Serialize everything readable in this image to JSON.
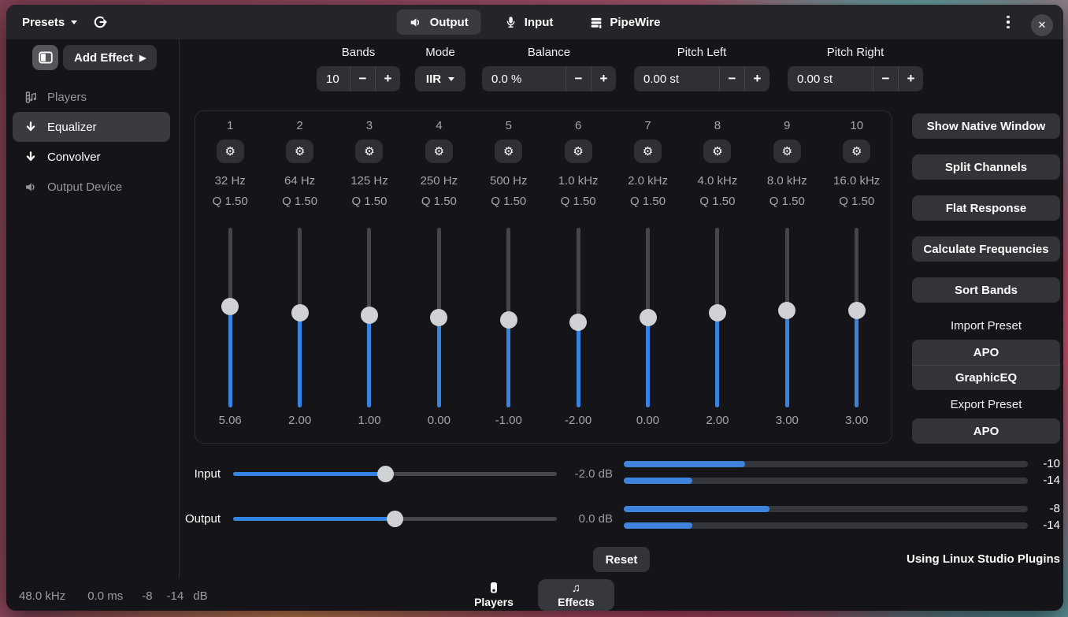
{
  "header": {
    "presets": {
      "label": "Presets"
    },
    "tabs": [
      {
        "id": "output",
        "label": "Output",
        "icon": "speaker-icon",
        "active": true
      },
      {
        "id": "input",
        "label": "Input",
        "icon": "mic-icon",
        "active": false
      },
      {
        "id": "pipewire",
        "label": "PipeWire",
        "icon": "pipewire-icon",
        "active": false
      }
    ]
  },
  "sidebar": {
    "add_effect": {
      "label": "Add Effect"
    },
    "items": [
      {
        "id": "players",
        "label": "Players",
        "icon": "players-icon",
        "dim": true,
        "selected": false
      },
      {
        "id": "equalizer",
        "label": "Equalizer",
        "icon": "down-arrow-icon",
        "dim": false,
        "selected": true
      },
      {
        "id": "convolver",
        "label": "Convolver",
        "icon": "down-arrow-icon",
        "dim": false,
        "selected": false
      },
      {
        "id": "output-device",
        "label": "Output Device",
        "icon": "speaker-icon",
        "dim": true,
        "selected": false
      }
    ]
  },
  "controls": {
    "bands": {
      "label": "Bands",
      "value": "10"
    },
    "mode": {
      "label": "Mode",
      "value": "IIR"
    },
    "balance": {
      "label": "Balance",
      "value": "0.0 %"
    },
    "pitch_left": {
      "label": "Pitch Left",
      "value": "0.00 st"
    },
    "pitch_right": {
      "label": "Pitch Right",
      "value": "0.00 st"
    }
  },
  "equalizer": {
    "slider_min_db": -36,
    "slider_max_db": 36,
    "bands": [
      {
        "number": "1",
        "freq": "32 Hz",
        "q": "Q 1.50",
        "gain_db": 5.06,
        "gain_label": "5.06"
      },
      {
        "number": "2",
        "freq": "64 Hz",
        "q": "Q 1.50",
        "gain_db": 2.0,
        "gain_label": "2.00"
      },
      {
        "number": "3",
        "freq": "125 Hz",
        "q": "Q 1.50",
        "gain_db": 1.0,
        "gain_label": "1.00"
      },
      {
        "number": "4",
        "freq": "250 Hz",
        "q": "Q 1.50",
        "gain_db": 0.0,
        "gain_label": "0.00"
      },
      {
        "number": "5",
        "freq": "500 Hz",
        "q": "Q 1.50",
        "gain_db": -1.0,
        "gain_label": "-1.00"
      },
      {
        "number": "6",
        "freq": "1.0 kHz",
        "q": "Q 1.50",
        "gain_db": -2.0,
        "gain_label": "-2.00"
      },
      {
        "number": "7",
        "freq": "2.0 kHz",
        "q": "Q 1.50",
        "gain_db": 0.0,
        "gain_label": "0.00"
      },
      {
        "number": "8",
        "freq": "4.0 kHz",
        "q": "Q 1.50",
        "gain_db": 2.0,
        "gain_label": "2.00"
      },
      {
        "number": "9",
        "freq": "8.0 kHz",
        "q": "Q 1.50",
        "gain_db": 3.0,
        "gain_label": "3.00"
      },
      {
        "number": "10",
        "freq": "16.0 kHz",
        "q": "Q 1.50",
        "gain_db": 3.0,
        "gain_label": "3.00"
      }
    ]
  },
  "right_panel": {
    "buttons": [
      {
        "label": "Show Native Window"
      },
      {
        "label": "Split Channels"
      },
      {
        "label": "Flat Response"
      },
      {
        "label": "Calculate Frequencies"
      },
      {
        "label": "Sort Bands"
      }
    ],
    "import_preset": {
      "label": "Import Preset",
      "options": [
        {
          "label": "APO"
        },
        {
          "label": "GraphicEQ"
        }
      ]
    },
    "export_preset": {
      "label": "Export Preset",
      "options": [
        {
          "label": "APO"
        }
      ]
    }
  },
  "io": {
    "input": {
      "label": "Input",
      "gain_label": "-2.0 dB",
      "slider_pct": 47
    },
    "output": {
      "label": "Output",
      "gain_label": "0.0 dB",
      "slider_pct": 50
    },
    "meters": [
      {
        "channel": "input-left",
        "fill_pct": 30,
        "value": "-10"
      },
      {
        "channel": "input-right",
        "fill_pct": 17,
        "value": "-14"
      },
      {
        "channel": "output-left",
        "fill_pct": 36,
        "value": "-8"
      },
      {
        "channel": "output-right",
        "fill_pct": 17,
        "value": "-14"
      }
    ]
  },
  "footer": {
    "reset_label": "Reset",
    "plugin_note": "Using Linux Studio Plugins",
    "status": {
      "sample_rate": "48.0 kHz",
      "latency": "0.0 ms",
      "level_left": "-8",
      "level_right": "-14",
      "unit": "dB"
    },
    "tabs": [
      {
        "label": "Players",
        "icon": "player-box-icon",
        "active": false
      },
      {
        "label": "Effects",
        "icon": "music-note-icon",
        "active": true
      }
    ]
  },
  "colors": {
    "accent": "#3584e4",
    "meter_fill": "#3e84dc",
    "header_bg": "#242429",
    "window_bg": "#141419"
  }
}
